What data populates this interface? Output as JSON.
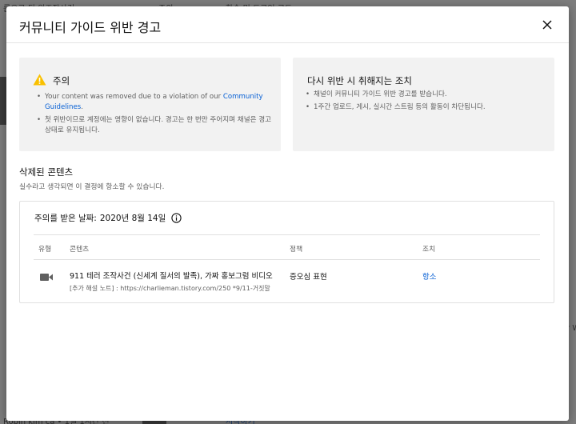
{
  "background": {
    "frag_top_left": "름으로 된 위조작사건",
    "frag_top_left_tag": "주의",
    "frag_top_mid": "학습 및 드로잉 로드",
    "frag_bottom_left": "Robin kim ca • 1일 1시간 전",
    "frag_bottom_link": "시작하기",
    "frag_right": "r W"
  },
  "modal": {
    "title": "커뮤니티 가이드 위반 경고",
    "close_icon": "close-icon"
  },
  "warning_card": {
    "title": "주의",
    "icon": "warning-triangle-icon",
    "bullet1_text": "Your content was removed due to a violation of our ",
    "bullet1_link": "Community Guidelines",
    "bullet1_end": ".",
    "bullet2": "첫 위반이므로 계정에는 영향이 없습니다. 경고는 한 번만 주어지며 채널은 경고 상태로 유지됩니다."
  },
  "repeat_card": {
    "title": "다시 위반 시 취해지는 조치",
    "bullet1": "채널이 커뮤니티 가이드 위반 경고를 받습니다.",
    "bullet2": "1주간 업로드, 게시, 실시간 스트림 등의 활동이 차단됩니다."
  },
  "removed_section": {
    "title": "삭제된 콘텐츠",
    "subtitle": "실수라고 생각되면 이 결정에 항소할 수 있습니다."
  },
  "strike": {
    "date_label": "주의를 받은 날짜:",
    "date_value": "2020년 8월 14일",
    "info_icon": "info-icon"
  },
  "table": {
    "headers": {
      "type": "유형",
      "content": "콘텐츠",
      "policy": "정책",
      "action": "조치"
    },
    "rows": [
      {
        "type_icon": "video-icon",
        "content_title": "911 테러 조작사건 (신세계 질서의 발족), 가짜 홍보그럼 비디오",
        "content_note": "[추가 해설 노트] : https://charlieman.tistory.com/250 *9/11-거짓말",
        "policy": "증오심 표현",
        "action": "항소"
      }
    ]
  }
}
